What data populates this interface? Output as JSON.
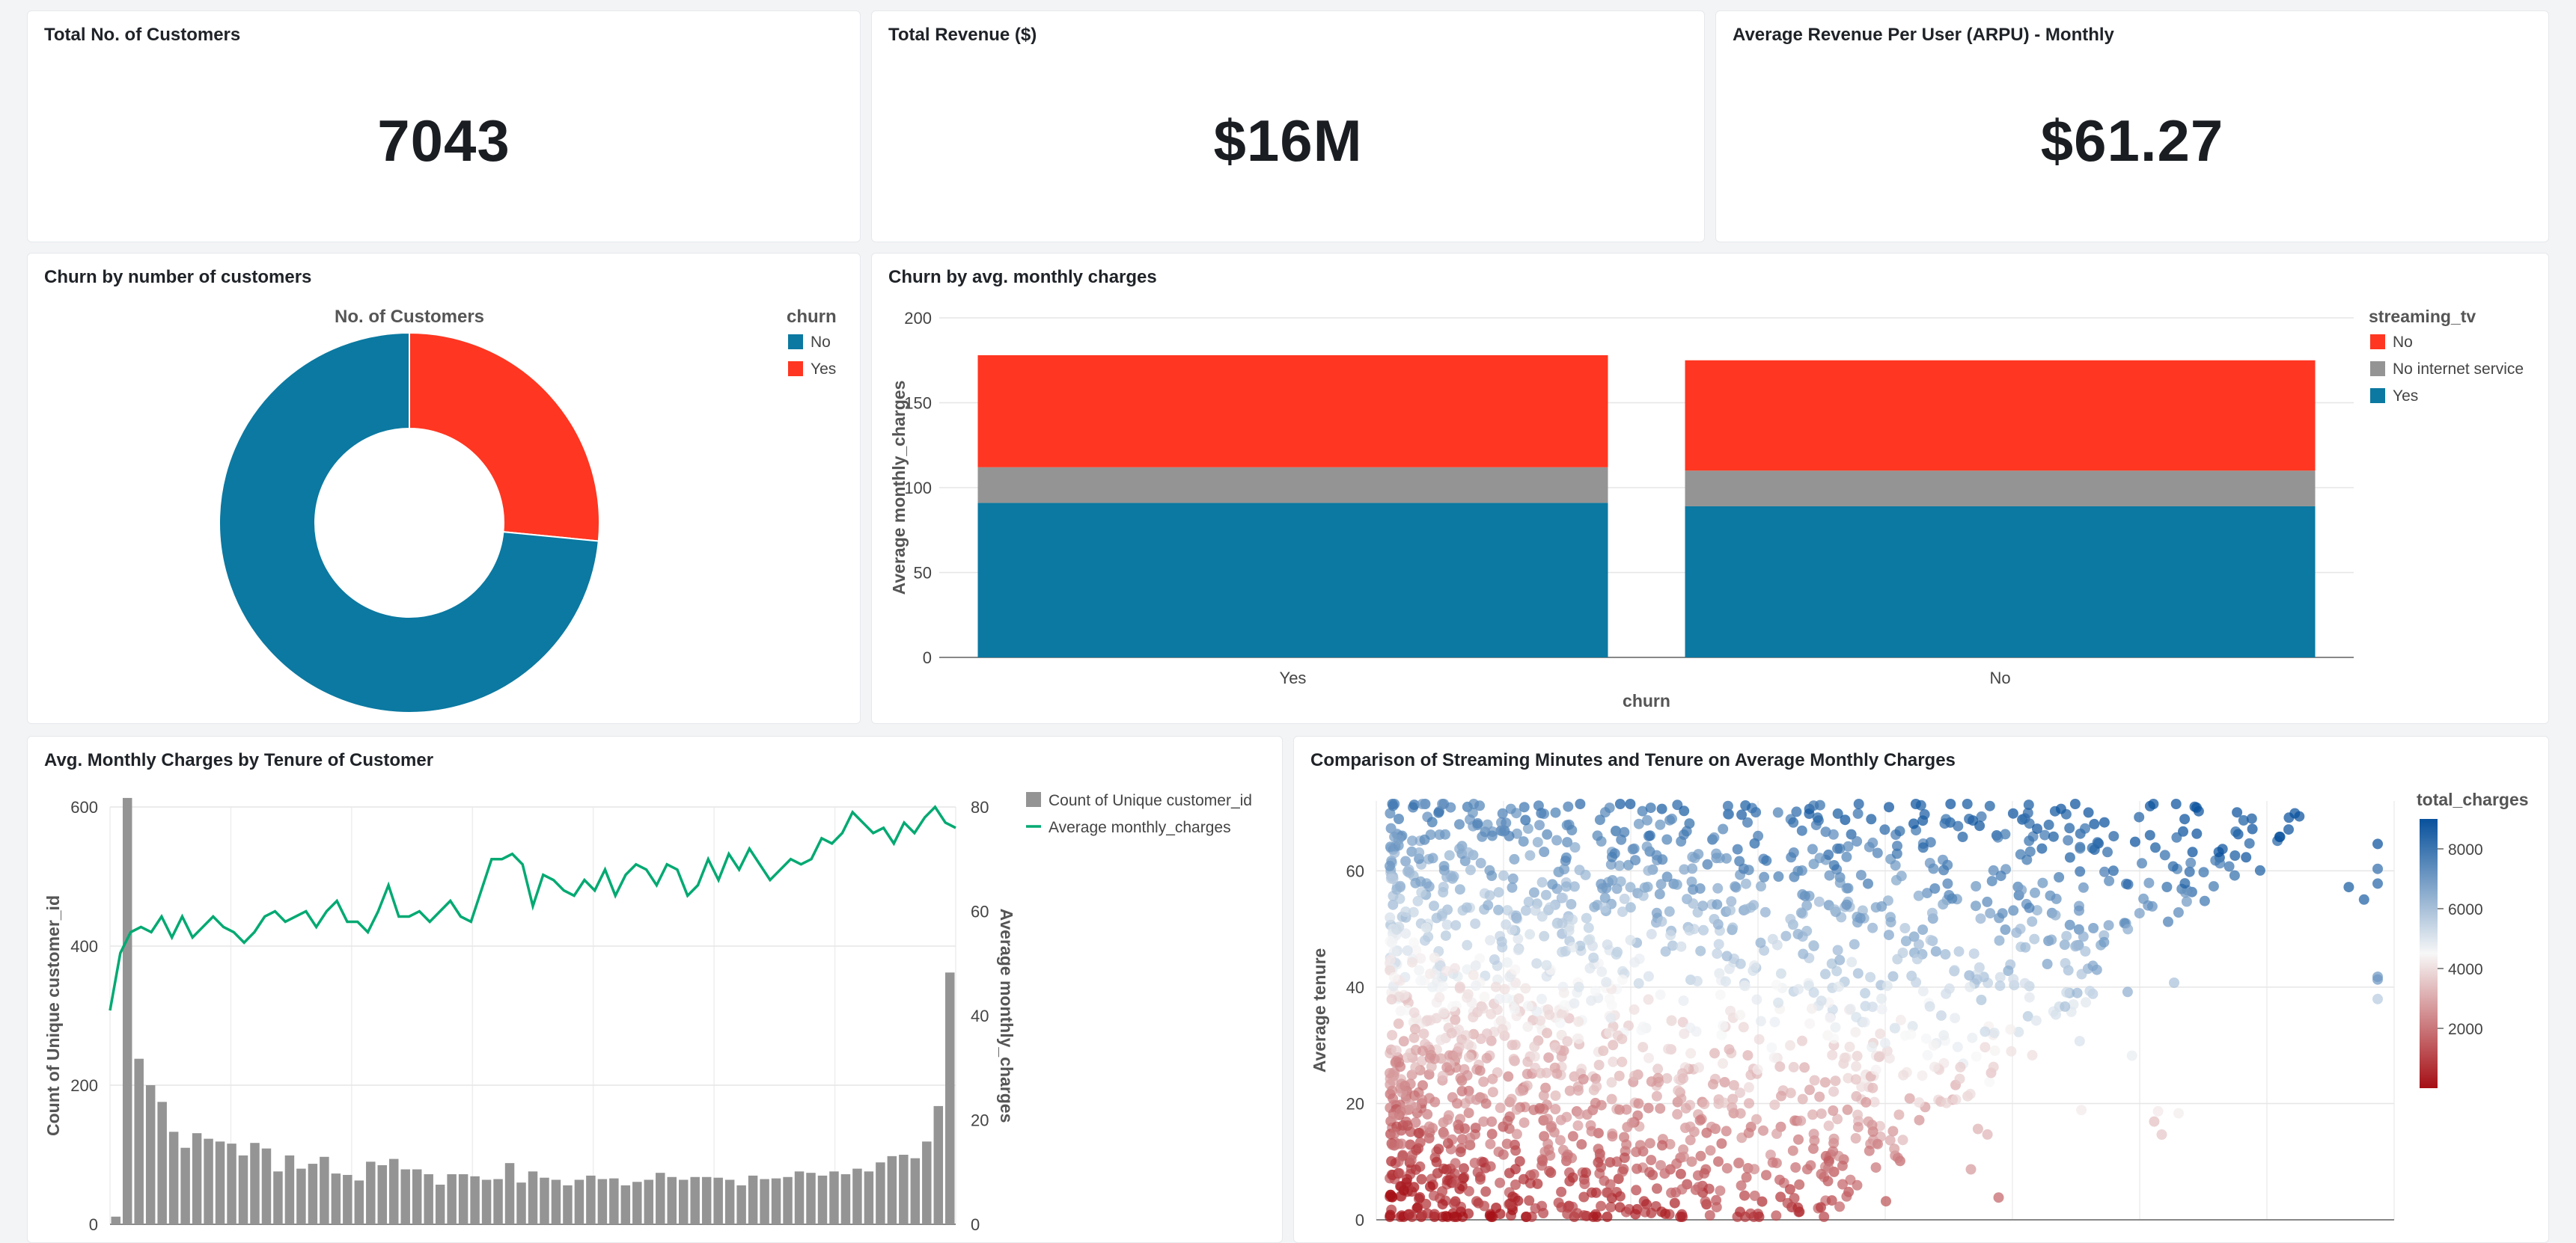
{
  "kpis": [
    {
      "title": "Total No. of Customers",
      "value": "7043"
    },
    {
      "title": "Total Revenue ($)",
      "value": "$16M"
    },
    {
      "title": "Average Revenue Per User (ARPU) - Monthly",
      "value": "$61.27"
    }
  ],
  "donut": {
    "card_title": "Churn by number of customers",
    "chart_data": {
      "type": "pie",
      "title": "No. of Customers",
      "legend_title": "churn",
      "legend_position": "top-right",
      "slices": [
        {
          "name": "No",
          "value": 5174,
          "color": "#0b79a1"
        },
        {
          "name": "Yes",
          "value": 1869,
          "color": "#ff3621"
        }
      ]
    }
  },
  "stacked": {
    "card_title": "Churn by avg. monthly charges",
    "chart_data": {
      "type": "bar",
      "stacked": true,
      "categories": [
        "Yes",
        "No"
      ],
      "xlabel": "churn",
      "ylabel": "Average monthly_charges",
      "ylim": [
        0,
        200
      ],
      "yticks": [
        0,
        50,
        100,
        150,
        200
      ],
      "legend_title": "streaming_tv",
      "legend_position": "top-right",
      "grid": true,
      "series": [
        {
          "name": "Yes",
          "color": "#0b79a1",
          "values": [
            91,
            89
          ]
        },
        {
          "name": "No internet service",
          "color": "#949494",
          "values": [
            21,
            21
          ]
        },
        {
          "name": "No",
          "color": "#ff3621",
          "values": [
            66,
            65
          ]
        }
      ],
      "legend_order": [
        "No",
        "No internet service",
        "Yes"
      ]
    }
  },
  "combo": {
    "card_title": "Avg. Monthly Charges by Tenure of Customer",
    "chart_data": {
      "type": "bar",
      "x_range": [
        0,
        72
      ],
      "ylabel": "Count of Unique customer_id",
      "ylim": [
        0,
        600
      ],
      "yticks": [
        0,
        200,
        400,
        600
      ],
      "y2label": "Average monthly_charges",
      "y2lim": [
        0,
        80
      ],
      "y2ticks": [
        0,
        20,
        40,
        60,
        80
      ],
      "legend_position": "top-right",
      "grid": true,
      "series": [
        {
          "name": "Count of Unique customer_id",
          "type": "bar",
          "color": "#949494",
          "values": [
            11,
            613,
            238,
            200,
            176,
            133,
            110,
            131,
            123,
            119,
            116,
            99,
            117,
            109,
            76,
            99,
            80,
            87,
            97,
            73,
            71,
            63,
            90,
            85,
            94,
            79,
            79,
            72,
            57,
            72,
            72,
            69,
            64,
            65,
            88,
            60,
            76,
            67,
            64,
            56,
            64,
            70,
            65,
            66,
            56,
            61,
            64,
            74,
            68,
            64,
            68,
            68,
            67,
            64,
            56,
            70,
            65,
            66,
            68,
            76,
            74,
            70,
            76,
            72,
            80,
            76,
            89,
            98,
            100,
            95,
            119,
            170,
            362
          ]
        },
        {
          "name": "Average monthly_charges",
          "type": "line",
          "color": "#00a972",
          "values": [
            41,
            52,
            56,
            57,
            56,
            59,
            55,
            59,
            55,
            57,
            59,
            57,
            56,
            54,
            56,
            59,
            60,
            58,
            59,
            60,
            57,
            60,
            62,
            58,
            58,
            56,
            60,
            65,
            59,
            59,
            60,
            58,
            60,
            62,
            59,
            58,
            64,
            70,
            70,
            71,
            69,
            61,
            67,
            66,
            64,
            63,
            66,
            64,
            68,
            63,
            67,
            69,
            68,
            65,
            69,
            68,
            63,
            65,
            70,
            66,
            71,
            68,
            72,
            69,
            66,
            68,
            70,
            69,
            70,
            74,
            73,
            75,
            79,
            77,
            75,
            76,
            73,
            77,
            75,
            78,
            80,
            77,
            76
          ]
        }
      ]
    }
  },
  "scatter": {
    "card_title": "Comparison of Streaming Minutes and Tenure on Average Monthly Charges",
    "chart_data": {
      "type": "scatter",
      "ylabel": "Average tenure",
      "xlabel": "",
      "ylim": [
        0,
        72
      ],
      "yticks": [
        0,
        20,
        40,
        60
      ],
      "legend_title": "total_charges",
      "legend_ticks": [
        2000,
        4000,
        6000,
        8000
      ],
      "color_scale": [
        "#a50f15",
        "#f7f7f7",
        "#08519c"
      ],
      "grid": true,
      "density_note": "approx. 2000 points; dense at low x, sparse at high x"
    }
  }
}
